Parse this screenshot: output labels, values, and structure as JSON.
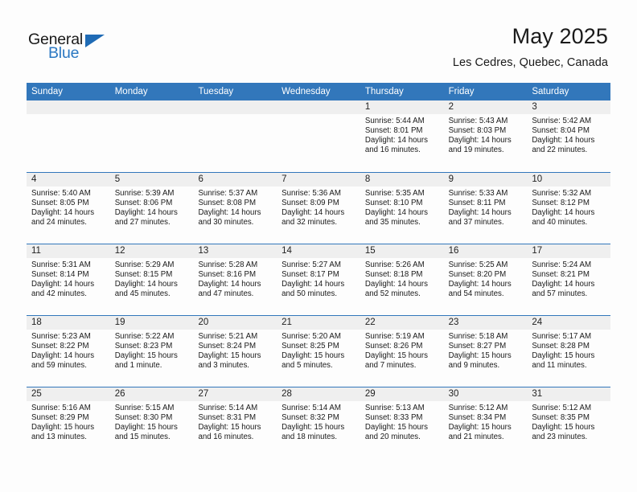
{
  "brand": {
    "name_part1": "General",
    "name_part2": "Blue"
  },
  "header": {
    "title": "May 2025",
    "location": "Les Cedres, Quebec, Canada"
  },
  "colors": {
    "header_blue": "#3277bb",
    "daynum_band": "#efefef",
    "brand_blue": "#2b78c2",
    "page_background": "#fdfdfd"
  },
  "weekdays": [
    "Sunday",
    "Monday",
    "Tuesday",
    "Wednesday",
    "Thursday",
    "Friday",
    "Saturday"
  ],
  "weeks": [
    [
      {
        "day": "",
        "lines": []
      },
      {
        "day": "",
        "lines": []
      },
      {
        "day": "",
        "lines": []
      },
      {
        "day": "",
        "lines": []
      },
      {
        "day": "1",
        "lines": [
          "Sunrise: 5:44 AM",
          "Sunset: 8:01 PM",
          "Daylight: 14 hours",
          "and 16 minutes."
        ]
      },
      {
        "day": "2",
        "lines": [
          "Sunrise: 5:43 AM",
          "Sunset: 8:03 PM",
          "Daylight: 14 hours",
          "and 19 minutes."
        ]
      },
      {
        "day": "3",
        "lines": [
          "Sunrise: 5:42 AM",
          "Sunset: 8:04 PM",
          "Daylight: 14 hours",
          "and 22 minutes."
        ]
      }
    ],
    [
      {
        "day": "4",
        "lines": [
          "Sunrise: 5:40 AM",
          "Sunset: 8:05 PM",
          "Daylight: 14 hours",
          "and 24 minutes."
        ]
      },
      {
        "day": "5",
        "lines": [
          "Sunrise: 5:39 AM",
          "Sunset: 8:06 PM",
          "Daylight: 14 hours",
          "and 27 minutes."
        ]
      },
      {
        "day": "6",
        "lines": [
          "Sunrise: 5:37 AM",
          "Sunset: 8:08 PM",
          "Daylight: 14 hours",
          "and 30 minutes."
        ]
      },
      {
        "day": "7",
        "lines": [
          "Sunrise: 5:36 AM",
          "Sunset: 8:09 PM",
          "Daylight: 14 hours",
          "and 32 minutes."
        ]
      },
      {
        "day": "8",
        "lines": [
          "Sunrise: 5:35 AM",
          "Sunset: 8:10 PM",
          "Daylight: 14 hours",
          "and 35 minutes."
        ]
      },
      {
        "day": "9",
        "lines": [
          "Sunrise: 5:33 AM",
          "Sunset: 8:11 PM",
          "Daylight: 14 hours",
          "and 37 minutes."
        ]
      },
      {
        "day": "10",
        "lines": [
          "Sunrise: 5:32 AM",
          "Sunset: 8:12 PM",
          "Daylight: 14 hours",
          "and 40 minutes."
        ]
      }
    ],
    [
      {
        "day": "11",
        "lines": [
          "Sunrise: 5:31 AM",
          "Sunset: 8:14 PM",
          "Daylight: 14 hours",
          "and 42 minutes."
        ]
      },
      {
        "day": "12",
        "lines": [
          "Sunrise: 5:29 AM",
          "Sunset: 8:15 PM",
          "Daylight: 14 hours",
          "and 45 minutes."
        ]
      },
      {
        "day": "13",
        "lines": [
          "Sunrise: 5:28 AM",
          "Sunset: 8:16 PM",
          "Daylight: 14 hours",
          "and 47 minutes."
        ]
      },
      {
        "day": "14",
        "lines": [
          "Sunrise: 5:27 AM",
          "Sunset: 8:17 PM",
          "Daylight: 14 hours",
          "and 50 minutes."
        ]
      },
      {
        "day": "15",
        "lines": [
          "Sunrise: 5:26 AM",
          "Sunset: 8:18 PM",
          "Daylight: 14 hours",
          "and 52 minutes."
        ]
      },
      {
        "day": "16",
        "lines": [
          "Sunrise: 5:25 AM",
          "Sunset: 8:20 PM",
          "Daylight: 14 hours",
          "and 54 minutes."
        ]
      },
      {
        "day": "17",
        "lines": [
          "Sunrise: 5:24 AM",
          "Sunset: 8:21 PM",
          "Daylight: 14 hours",
          "and 57 minutes."
        ]
      }
    ],
    [
      {
        "day": "18",
        "lines": [
          "Sunrise: 5:23 AM",
          "Sunset: 8:22 PM",
          "Daylight: 14 hours",
          "and 59 minutes."
        ]
      },
      {
        "day": "19",
        "lines": [
          "Sunrise: 5:22 AM",
          "Sunset: 8:23 PM",
          "Daylight: 15 hours",
          "and 1 minute."
        ]
      },
      {
        "day": "20",
        "lines": [
          "Sunrise: 5:21 AM",
          "Sunset: 8:24 PM",
          "Daylight: 15 hours",
          "and 3 minutes."
        ]
      },
      {
        "day": "21",
        "lines": [
          "Sunrise: 5:20 AM",
          "Sunset: 8:25 PM",
          "Daylight: 15 hours",
          "and 5 minutes."
        ]
      },
      {
        "day": "22",
        "lines": [
          "Sunrise: 5:19 AM",
          "Sunset: 8:26 PM",
          "Daylight: 15 hours",
          "and 7 minutes."
        ]
      },
      {
        "day": "23",
        "lines": [
          "Sunrise: 5:18 AM",
          "Sunset: 8:27 PM",
          "Daylight: 15 hours",
          "and 9 minutes."
        ]
      },
      {
        "day": "24",
        "lines": [
          "Sunrise: 5:17 AM",
          "Sunset: 8:28 PM",
          "Daylight: 15 hours",
          "and 11 minutes."
        ]
      }
    ],
    [
      {
        "day": "25",
        "lines": [
          "Sunrise: 5:16 AM",
          "Sunset: 8:29 PM",
          "Daylight: 15 hours",
          "and 13 minutes."
        ]
      },
      {
        "day": "26",
        "lines": [
          "Sunrise: 5:15 AM",
          "Sunset: 8:30 PM",
          "Daylight: 15 hours",
          "and 15 minutes."
        ]
      },
      {
        "day": "27",
        "lines": [
          "Sunrise: 5:14 AM",
          "Sunset: 8:31 PM",
          "Daylight: 15 hours",
          "and 16 minutes."
        ]
      },
      {
        "day": "28",
        "lines": [
          "Sunrise: 5:14 AM",
          "Sunset: 8:32 PM",
          "Daylight: 15 hours",
          "and 18 minutes."
        ]
      },
      {
        "day": "29",
        "lines": [
          "Sunrise: 5:13 AM",
          "Sunset: 8:33 PM",
          "Daylight: 15 hours",
          "and 20 minutes."
        ]
      },
      {
        "day": "30",
        "lines": [
          "Sunrise: 5:12 AM",
          "Sunset: 8:34 PM",
          "Daylight: 15 hours",
          "and 21 minutes."
        ]
      },
      {
        "day": "31",
        "lines": [
          "Sunrise: 5:12 AM",
          "Sunset: 8:35 PM",
          "Daylight: 15 hours",
          "and 23 minutes."
        ]
      }
    ]
  ]
}
